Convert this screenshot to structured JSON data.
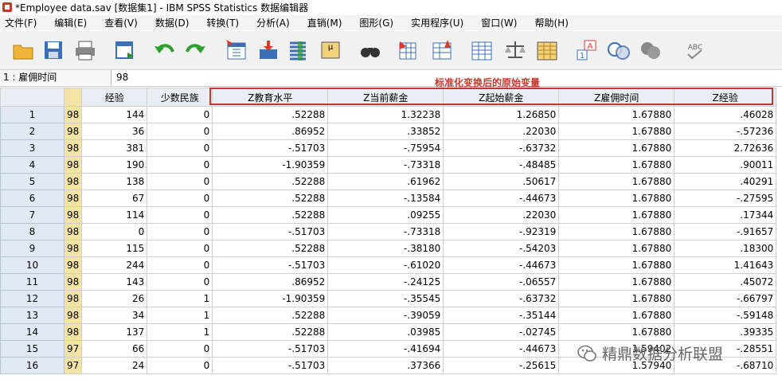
{
  "window": {
    "title": "*Employee data.sav [数据集1] - IBM SPSS Statistics 数据编辑器"
  },
  "menu": [
    "文件(F)",
    "编辑(E)",
    "查看(V)",
    "数据(D)",
    "转换(T)",
    "分析(A)",
    "直销(M)",
    "图形(G)",
    "实用程序(U)",
    "窗口(W)",
    "帮助(H)"
  ],
  "toolbar_icons": [
    "open-folder-icon",
    "save-icon",
    "print-icon",
    "recall-dialog-icon",
    "undo-icon",
    "redo-icon",
    "goto-case-icon",
    "goto-variable-icon",
    "variables-icon",
    "descriptive-stats-icon",
    "find-icon",
    "insert-cases-icon",
    "insert-variable-icon",
    "split-file-icon",
    "weight-cases-icon",
    "select-cases-icon",
    "value-labels-icon",
    "use-sets-icon",
    "show-all-variables-icon",
    "spell-check-icon"
  ],
  "cell_editor": {
    "ref": "1 : 雇佣时间",
    "value": "98"
  },
  "annotation": "标准化变换后的原始变量",
  "columns": [
    "经验",
    "少数民族",
    "Z教育水平",
    "Z当前薪金",
    "Z起始薪金",
    "Z雇佣时间",
    "Z经验"
  ],
  "rows": [
    {
      "n": "1",
      "h": "98",
      "c": [
        "144",
        "0",
        ".52288",
        "1.32238",
        "1.26850",
        "1.67880",
        ".46028"
      ]
    },
    {
      "n": "2",
      "h": "98",
      "c": [
        "36",
        "0",
        ".86952",
        ".33852",
        ".22030",
        "1.67880",
        "-.57236"
      ]
    },
    {
      "n": "3",
      "h": "98",
      "c": [
        "381",
        "0",
        "-.51703",
        "-.75954",
        "-.63732",
        "1.67880",
        "2.72636"
      ]
    },
    {
      "n": "4",
      "h": "98",
      "c": [
        "190",
        "0",
        "-1.90359",
        "-.73318",
        "-.48485",
        "1.67880",
        ".90011"
      ]
    },
    {
      "n": "5",
      "h": "98",
      "c": [
        "138",
        "0",
        ".52288",
        ".61962",
        ".50617",
        "1.67880",
        ".40291"
      ]
    },
    {
      "n": "6",
      "h": "98",
      "c": [
        "67",
        "0",
        ".52288",
        "-.13584",
        "-.44673",
        "1.67880",
        "-.27595"
      ]
    },
    {
      "n": "7",
      "h": "98",
      "c": [
        "114",
        "0",
        ".52288",
        ".09255",
        ".22030",
        "1.67880",
        ".17344"
      ]
    },
    {
      "n": "8",
      "h": "98",
      "c": [
        "0",
        "0",
        "-.51703",
        "-.73318",
        "-.92319",
        "1.67880",
        "-.91657"
      ]
    },
    {
      "n": "9",
      "h": "98",
      "c": [
        "115",
        "0",
        ".52288",
        "-.38180",
        "-.54203",
        "1.67880",
        ".18300"
      ]
    },
    {
      "n": "10",
      "h": "98",
      "c": [
        "244",
        "0",
        "-.51703",
        "-.61020",
        "-.44673",
        "1.67880",
        "1.41643"
      ]
    },
    {
      "n": "11",
      "h": "98",
      "c": [
        "143",
        "0",
        ".86952",
        "-.24125",
        "-.06557",
        "1.67880",
        ".45072"
      ]
    },
    {
      "n": "12",
      "h": "98",
      "c": [
        "26",
        "1",
        "-1.90359",
        "-.35545",
        "-.63732",
        "1.67880",
        "-.66797"
      ]
    },
    {
      "n": "13",
      "h": "98",
      "c": [
        "34",
        "1",
        ".52288",
        "-.39059",
        "-.35144",
        "1.67880",
        "-.59148"
      ]
    },
    {
      "n": "14",
      "h": "98",
      "c": [
        "137",
        "1",
        ".52288",
        ".03985",
        "-.02745",
        "1.67880",
        ".39335"
      ]
    },
    {
      "n": "15",
      "h": "97",
      "c": [
        "66",
        "0",
        "-.51703",
        "-.41694",
        "-.44673",
        "1.59402",
        "-.28551"
      ]
    },
    {
      "n": "16",
      "h": "97",
      "c": [
        "24",
        "0",
        "-.51703",
        ".37366",
        "-.25615",
        "1.57940",
        "-.68710"
      ]
    }
  ],
  "watermark": "精鼎数据分析联盟"
}
